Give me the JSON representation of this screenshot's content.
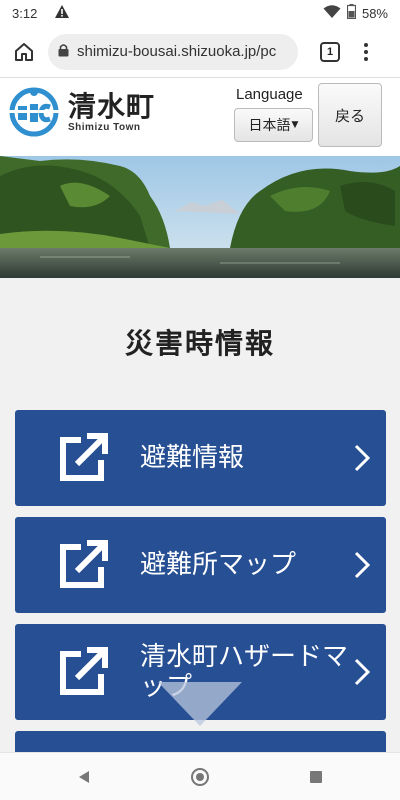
{
  "status_bar": {
    "time": "3:12",
    "alert_icon": "warning-icon",
    "battery_percent": "58%"
  },
  "browser": {
    "url": "shimizu-bousai.shizuoka.jp/pc",
    "tab_count": "1"
  },
  "header": {
    "logo_title": "清水町",
    "logo_subtitle": "Shimizu Town",
    "language_label": "Language",
    "language_selected": "日本語",
    "back_label": "戻る"
  },
  "main": {
    "section_title": "災害時情報",
    "links": [
      {
        "label": "避難情報"
      },
      {
        "label": "避難所マップ"
      },
      {
        "label": "清水町ハザードマップ"
      },
      {
        "label": ""
      }
    ]
  },
  "colors": {
    "card_blue": "#274f93",
    "logo_blue": "#2f8fcf"
  }
}
